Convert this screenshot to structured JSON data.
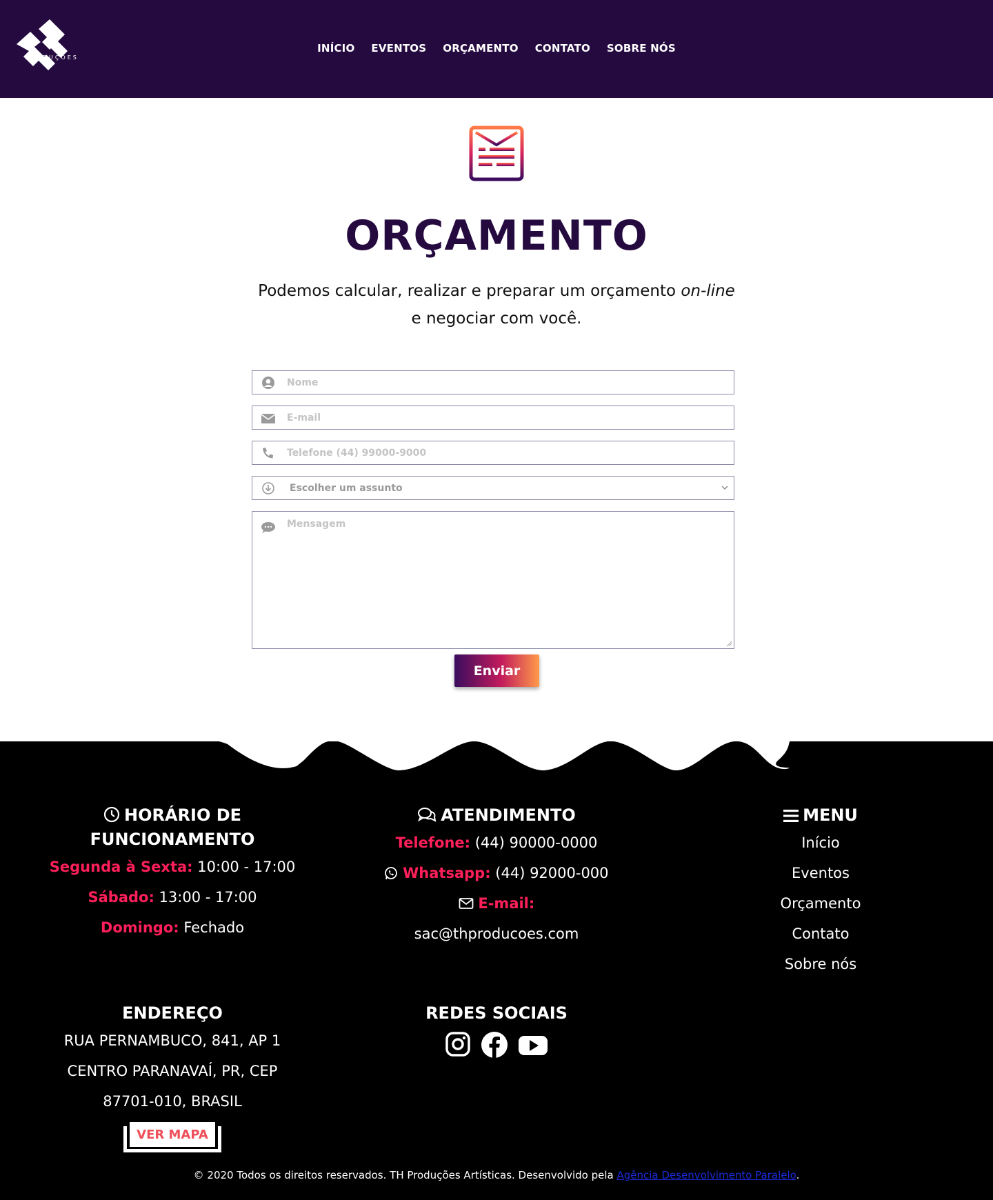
{
  "brand": {
    "logo_text": "PRODUÇÕES",
    "header_bg": "#250a40",
    "accent": "#ff1f5a"
  },
  "nav": [
    {
      "label": "INÍCIO"
    },
    {
      "label": "EVENTOS"
    },
    {
      "label": "ORÇAMENTO"
    },
    {
      "label": "CONTATO"
    },
    {
      "label": "SOBRE NÓS"
    }
  ],
  "main": {
    "icon": "budget-envelope-icon",
    "title": "ORÇAMENTO",
    "subtitle_before": "Podemos calcular, realizar e preparar um orçamento ",
    "subtitle_em": "on-line",
    "subtitle_after": " e negociar com você."
  },
  "form": {
    "name_placeholder": "Nome",
    "email_placeholder": "E-mail",
    "phone_placeholder": "Telefone (44) 99000-9000",
    "subject_selected": "Escolher um assunto",
    "message_placeholder": "Mensagem",
    "submit_label": "Enviar"
  },
  "footer": {
    "hours": {
      "title": "HORÁRIO DE FUNCIONAMENTO",
      "rows": [
        {
          "label": "Segunda à Sexta:",
          "value": " 10:00 - 17:00"
        },
        {
          "label": "Sábado:",
          "value": " 13:00 - 17:00"
        },
        {
          "label": "Domingo:",
          "value": " Fechado"
        }
      ]
    },
    "contact": {
      "title": "ATENDIMENTO",
      "phone_label": "Telefone:",
      "phone_value": " (44) 90000-0000",
      "whatsapp_label": "Whatsapp:",
      "whatsapp_value": " (44) 92000-000",
      "email_label": "E-mail:",
      "email_value": "sac@thproducoes.com"
    },
    "menu": {
      "title": "MENU",
      "items": [
        {
          "label": "Início"
        },
        {
          "label": "Eventos"
        },
        {
          "label": "Orçamento"
        },
        {
          "label": "Contato"
        },
        {
          "label": "Sobre nós"
        }
      ]
    },
    "address": {
      "title": "ENDEREÇO",
      "lines": [
        "RUA PERNAMBUCO, 841, AP 1",
        "CENTRO PARANAVAÍ, PR, CEP",
        "87701-010, BRASIL"
      ],
      "map_button": "VER MAPA"
    },
    "social": {
      "title": "REDES SOCIAIS",
      "icons": [
        "instagram-icon",
        "facebook-icon",
        "youtube-icon"
      ]
    },
    "copyright_text": "© 2020 Todos os direitos reservados. TH Produções Artísticas. Desenvolvido pela ",
    "copyright_link": "Agência Desenvolvimento Paralelo",
    "copyright_end": "."
  }
}
